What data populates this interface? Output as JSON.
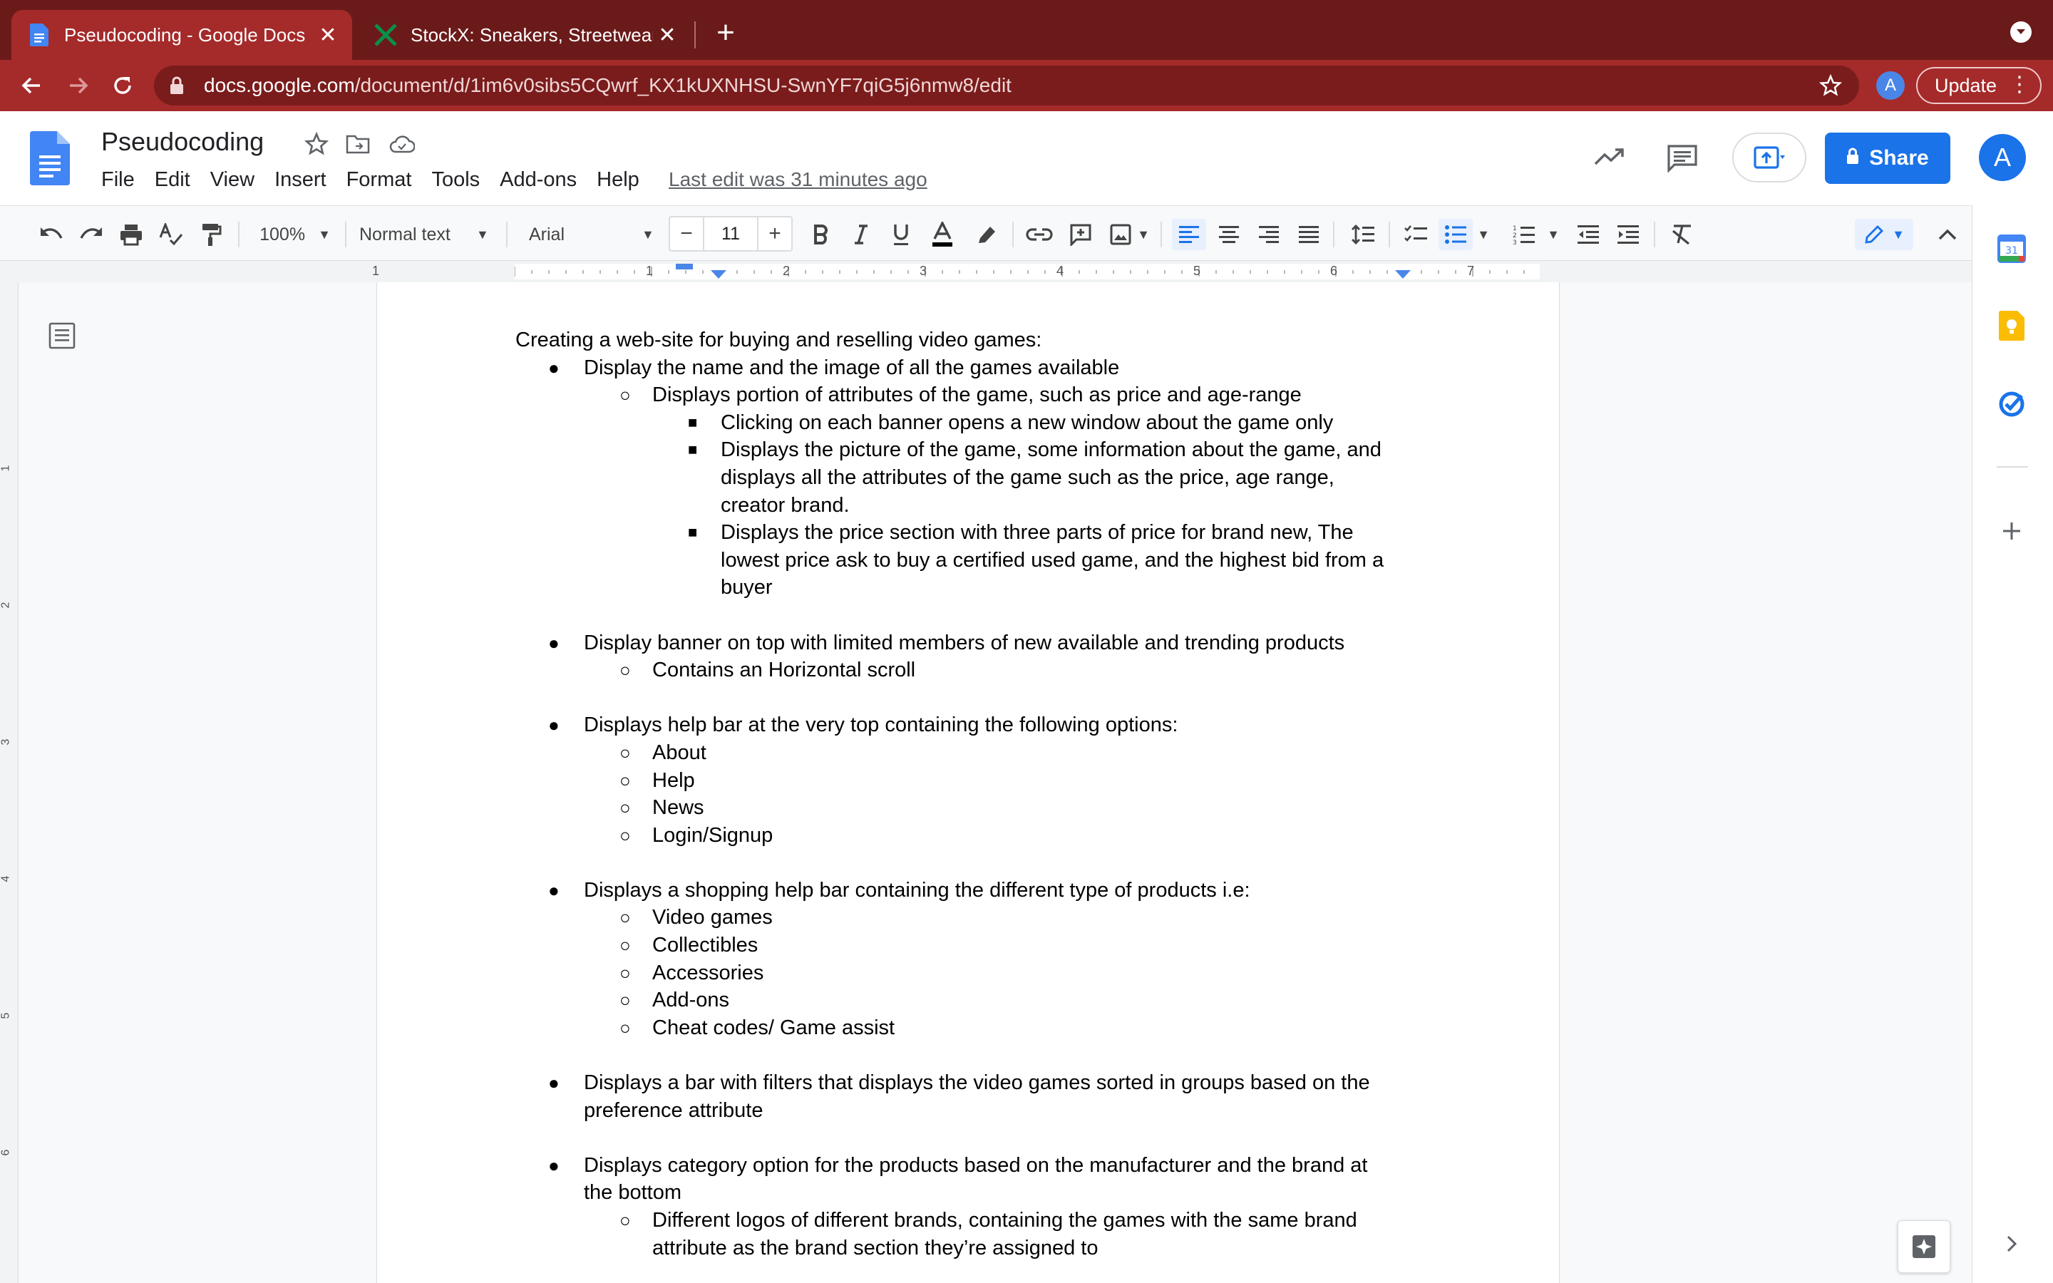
{
  "browser": {
    "tabs": [
      {
        "title": "Pseudocoding - Google Docs",
        "active": true
      },
      {
        "title": "StockX: Sneakers, Streetwear,",
        "active": false
      }
    ],
    "url_host": "docs.google.com",
    "url_path": "/document/d/1im6v0sibs5CQwrf_KX1kUXNHSU-SwnYF7qiG5j6nmw8/edit",
    "profile_initial": "A",
    "update_label": "Update"
  },
  "docs": {
    "title": "Pseudocoding",
    "menu": [
      "File",
      "Edit",
      "View",
      "Insert",
      "Format",
      "Tools",
      "Add-ons",
      "Help"
    ],
    "last_edit": "Last edit was 31 minutes ago",
    "share_label": "Share",
    "avatar_initial": "A",
    "accent": "#1a73e8"
  },
  "toolbar": {
    "zoom": "100%",
    "style": "Normal text",
    "font": "Arial",
    "font_size": "11"
  },
  "ruler": {
    "labels": [
      "1",
      "1",
      "2",
      "3",
      "4",
      "5",
      "6",
      "7"
    ],
    "vlabels": [
      "1",
      "2",
      "3",
      "4",
      "5",
      "6"
    ]
  },
  "document": {
    "heading": "Creating a web-site for buying and reselling video games:",
    "lines": [
      {
        "level": 1,
        "text": "Display the name and the image of all the games available"
      },
      {
        "level": 2,
        "text": "Displays portion of attributes of the game, such as price and age-range"
      },
      {
        "level": 3,
        "text": "Clicking on each banner opens a new window about the game only"
      },
      {
        "level": 3,
        "text": "Displays the picture of the game, some information about the game, and"
      },
      {
        "level": 3,
        "cont": true,
        "text": "displays all the attributes of the game such as the price, age range,"
      },
      {
        "level": 3,
        "cont": true,
        "text": "creator brand."
      },
      {
        "level": 3,
        "text": "Displays the price section with three parts of price for brand new, The"
      },
      {
        "level": 3,
        "cont": true,
        "text": "lowest price ask to buy a certified used game, and the highest bid from a"
      },
      {
        "level": 3,
        "cont": true,
        "text": "buyer"
      },
      {
        "level": 0,
        "gap": true,
        "text": ""
      },
      {
        "level": 1,
        "text": "Display banner on top with limited members of new available and trending products"
      },
      {
        "level": 2,
        "text": "Contains an Horizontal scroll"
      },
      {
        "level": 0,
        "gap": true,
        "text": ""
      },
      {
        "level": 1,
        "text": "Displays help bar at the very top containing the following options:"
      },
      {
        "level": 2,
        "text": "About"
      },
      {
        "level": 2,
        "text": "Help"
      },
      {
        "level": 2,
        "text": "News"
      },
      {
        "level": 2,
        "text": "Login/Signup"
      },
      {
        "level": 0,
        "gap": true,
        "text": ""
      },
      {
        "level": 1,
        "text": "Displays a shopping help bar containing the different type of products i.e:"
      },
      {
        "level": 2,
        "text": "Video games"
      },
      {
        "level": 2,
        "text": "Collectibles"
      },
      {
        "level": 2,
        "text": "Accessories"
      },
      {
        "level": 2,
        "text": "Add-ons"
      },
      {
        "level": 2,
        "text": "Cheat codes/ Game assist"
      },
      {
        "level": 0,
        "gap": true,
        "text": ""
      },
      {
        "level": 1,
        "text": "Displays a bar with filters that displays the video games sorted in groups based on the"
      },
      {
        "level": 1,
        "cont": true,
        "text": "preference attribute"
      },
      {
        "level": 0,
        "gap": true,
        "text": ""
      },
      {
        "level": 1,
        "text": "Displays category option for the products based on the manufacturer and the brand at"
      },
      {
        "level": 1,
        "cont": true,
        "text": "the bottom"
      },
      {
        "level": 2,
        "text": "Different logos of different brands, containing the games with the same brand"
      },
      {
        "level": 2,
        "cont": true,
        "text": "attribute as the brand section they’re assigned to"
      }
    ]
  },
  "sidepanel": {
    "calendar_day": "31"
  }
}
